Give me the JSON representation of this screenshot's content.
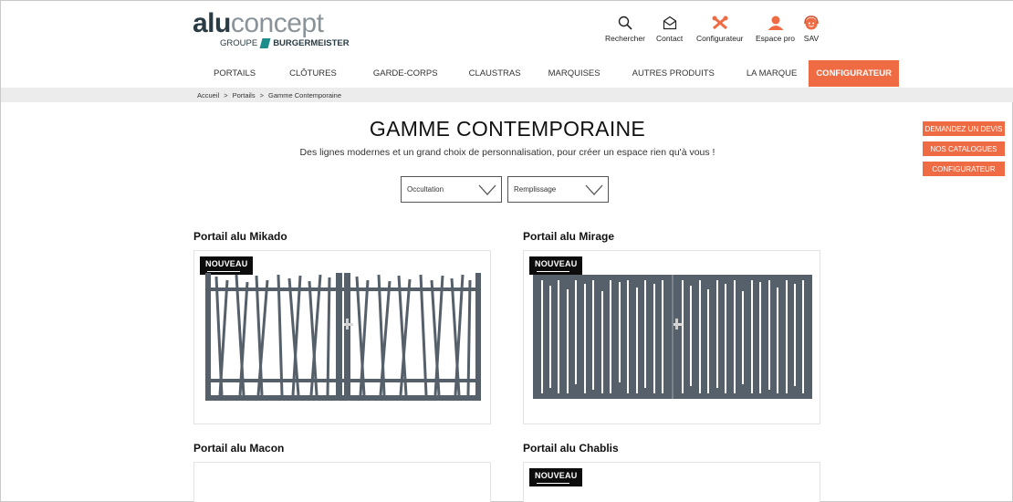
{
  "brand": {
    "logo_part1": "alu",
    "logo_part2": "concept",
    "group_prefix": "GROUPE",
    "group_name": "BURGERMEISTER"
  },
  "utility": {
    "search": "Rechercher",
    "contact": "Contact",
    "configurator": "Configurateur",
    "pro": "Espace pro",
    "sav": "SAV"
  },
  "nav": [
    "PORTAILS",
    "CLÔTURES",
    "GARDE-CORPS",
    "CLAUSTRAS",
    "MARQUISES",
    "AUTRES PRODUITS",
    "LA MARQUE",
    "CONFIGURATEUR"
  ],
  "breadcrumb": [
    "Accueil",
    "Portails",
    "Gamme Contemporaine"
  ],
  "breadcrumb_sep": ">",
  "side_buttons": [
    "DEMANDEZ UN DEVIS",
    "NOS CATALOGUES",
    "CONFIGURATEUR"
  ],
  "page": {
    "title": "GAMME CONTEMPORAINE",
    "subtitle": "Des lignes modernes et un grand choix de personnalisation, pour créer un espace rien qu'à vous !"
  },
  "filters": {
    "occultation": "Occultation",
    "remplissage": "Remplissage"
  },
  "products": [
    {
      "name": "Portail alu Mikado",
      "badge": "NOUVEAU"
    },
    {
      "name": "Portail alu Mirage",
      "badge": "NOUVEAU"
    },
    {
      "name": "Portail alu Macon"
    },
    {
      "name": "Portail alu Chablis",
      "badge": "NOUVEAU"
    }
  ],
  "colors": {
    "accent": "#ef6b43",
    "gate": "#56606a",
    "logo_dark": "#2a3b44",
    "logo_light": "#8a9399",
    "logo_mark": "#1b8d8a",
    "breadcrumb_bg": "#ececec"
  },
  "icons": {
    "search": "search-icon",
    "contact": "envelope-icon",
    "configurator": "tools-icon",
    "pro": "user-icon",
    "sav": "support-headset-icon",
    "select": "chevron-down-icon"
  }
}
